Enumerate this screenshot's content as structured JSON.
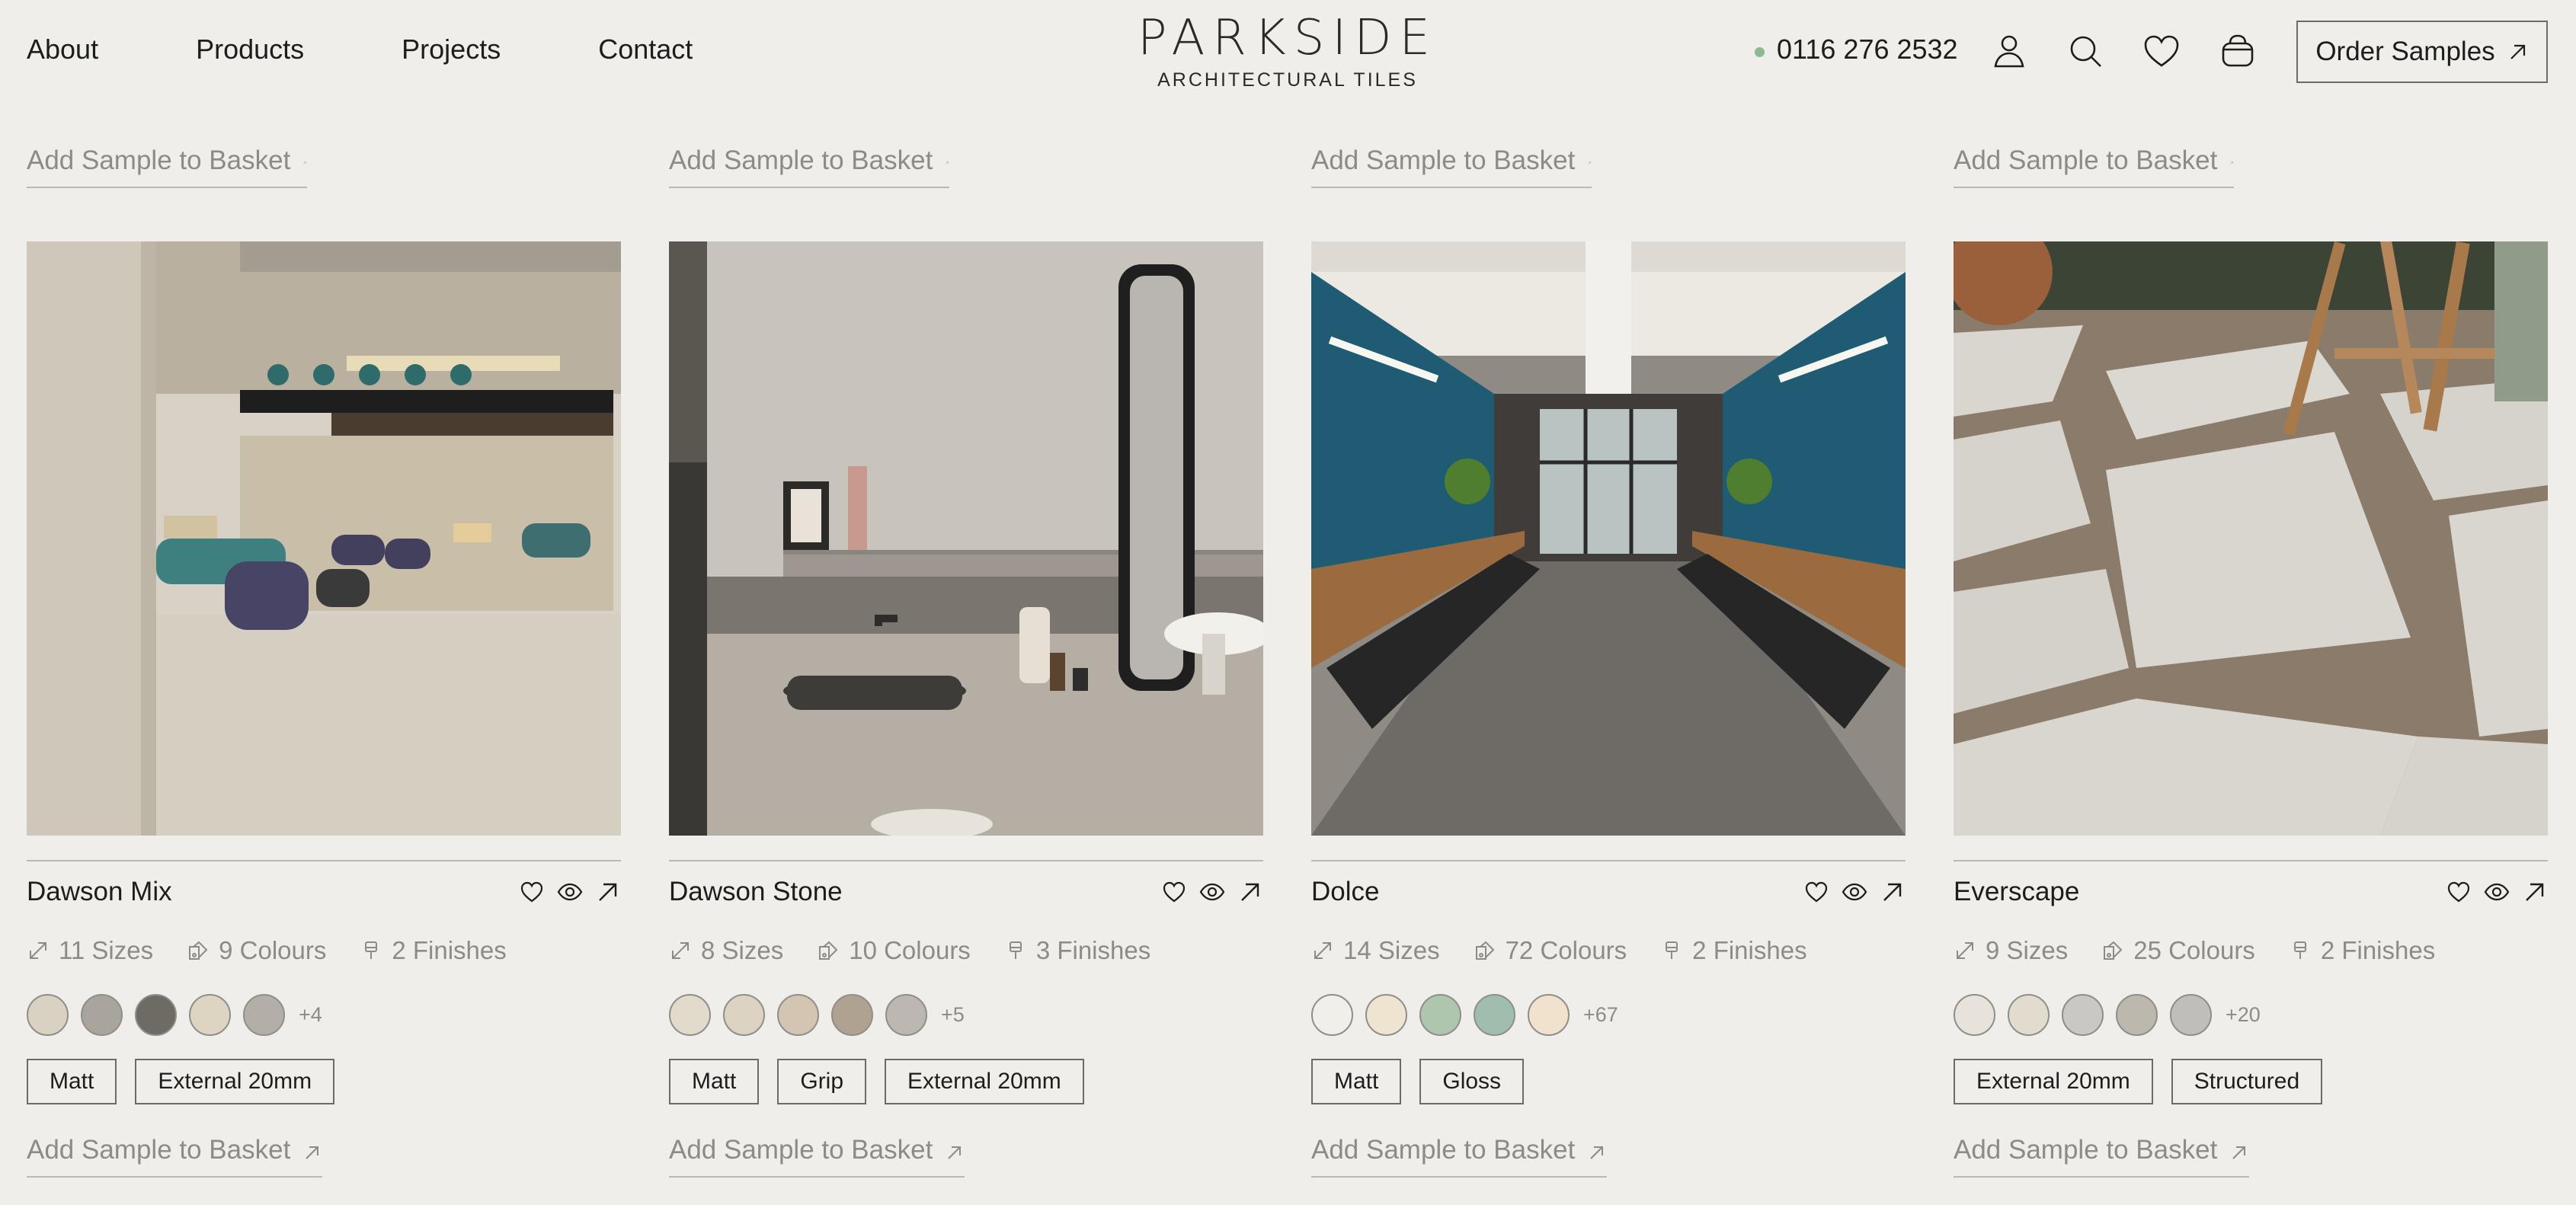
{
  "nav": {
    "items": [
      "About",
      "Products",
      "Projects",
      "Contact"
    ]
  },
  "logo": {
    "brand": "PARKSIDE",
    "tagline": "ARCHITECTURAL TILES"
  },
  "header": {
    "phone": "0116 276 2532",
    "order_samples": "Order Samples",
    "status_dot_color": "#8dba90",
    "icons": [
      "account-icon",
      "search-icon",
      "wishlist-heart-icon",
      "basket-icon"
    ]
  },
  "top_basket_links": [
    "Add Sample to Basket",
    "Add Sample to Basket",
    "Add Sample to Basket",
    "Add Sample to Basket"
  ],
  "products": [
    {
      "name": "Dawson Mix",
      "sizes": "11 Sizes",
      "colours": "9 Colours",
      "finishes_count": "2 Finishes",
      "swatches": [
        "#d9d2c3",
        "#a9a59c",
        "#6e6b64",
        "#ddd5c2",
        "#b3afa6"
      ],
      "more": "+4",
      "finishes": [
        "Matt",
        "External 20mm"
      ],
      "basket": "Add Sample to Basket"
    },
    {
      "name": "Dawson Stone",
      "sizes": "8 Sizes",
      "colours": "10 Colours",
      "finishes_count": "3 Finishes",
      "swatches": [
        "#e2dacb",
        "#ddd3c2",
        "#d3c5b1",
        "#b0a290",
        "#bcb8b1"
      ],
      "more": "+5",
      "finishes": [
        "Matt",
        "Grip",
        "External 20mm"
      ],
      "basket": "Add Sample to Basket"
    },
    {
      "name": "Dolce",
      "sizes": "14 Sizes",
      "colours": "72 Colours",
      "finishes_count": "2 Finishes",
      "swatches": [
        "#f1efea",
        "#efe4d0",
        "#aec6ad",
        "#9fbeae",
        "#f0e2cd"
      ],
      "more": "+67",
      "finishes": [
        "Matt",
        "Gloss"
      ],
      "basket": "Add Sample to Basket"
    },
    {
      "name": "Everscape",
      "sizes": "9 Sizes",
      "colours": "25 Colours",
      "finishes_count": "2 Finishes",
      "swatches": [
        "#e7e3da",
        "#e2dccf",
        "#c9c8c5",
        "#bdb8ad",
        "#c0bebb"
      ],
      "more": "+20",
      "finishes": [
        "External 20mm",
        "Structured"
      ],
      "basket": "Add Sample to Basket"
    }
  ]
}
